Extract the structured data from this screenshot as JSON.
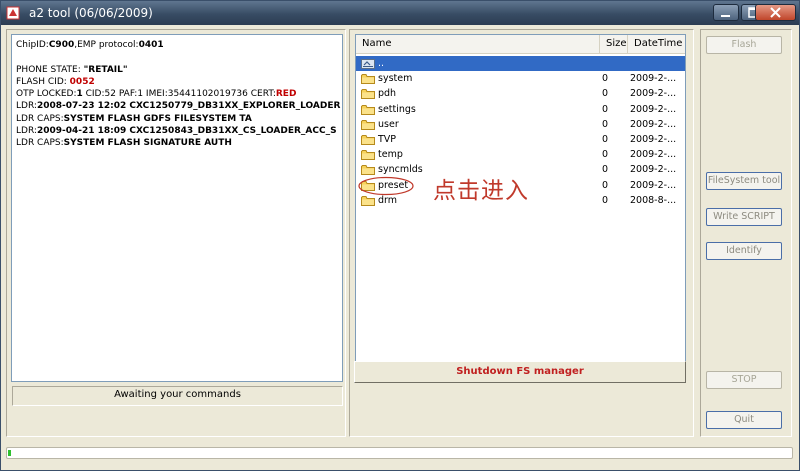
{
  "window": {
    "title": "a2 tool (06/06/2009)",
    "title_icon": "app-icon"
  },
  "info": {
    "lines": [
      {
        "prefix": "ChipID:",
        "value": "C900",
        "value_style": "bold",
        "suffix": ",EMP protocol:",
        "suffix_value": "0401"
      },
      {
        "prefix": "",
        "value": "",
        "value_style": "",
        "suffix": "",
        "suffix_value": ""
      },
      {
        "prefix": "PHONE STATE: ",
        "value": "\"RETAIL\"",
        "value_style": "bold",
        "suffix": "",
        "suffix_value": ""
      },
      {
        "prefix": "FLASH CID: ",
        "value": "0052",
        "value_style": "red",
        "suffix": "",
        "suffix_value": ""
      },
      {
        "prefix": "OTP LOCKED:",
        "value": "1",
        "value_style": "bold",
        "suffix": " CID:52 PAF:1 IMEI:35441102019736 CERT:",
        "suffix_value": "RED"
      },
      {
        "prefix": "LDR:",
        "value": "2008-07-23 12:02 CXC1250779_DB31XX_EXPLORER_LOADER",
        "value_style": "bold",
        "suffix": "",
        "suffix_value": ""
      },
      {
        "prefix": "LDR CAPS:",
        "value": "SYSTEM FLASH GDFS FILESYSTEM TA",
        "value_style": "bold",
        "suffix": "",
        "suffix_value": ""
      },
      {
        "prefix": "LDR:",
        "value": "2009-04-21 18:09 CXC1250843_DB31XX_CS_LOADER_ACC_S",
        "value_style": "bold",
        "suffix": "",
        "suffix_value": ""
      },
      {
        "prefix": "LDR CAPS:",
        "value": "SYSTEM FLASH SIGNATURE AUTH",
        "value_style": "bold",
        "suffix": "",
        "suffix_value": ""
      }
    ]
  },
  "status": {
    "text": "Awaiting your commands"
  },
  "filesystem": {
    "columns": [
      "Name",
      "Size",
      "DateTime"
    ],
    "rows": [
      {
        "name": "..",
        "size": "",
        "date": "",
        "icon": "parent-folder-icon",
        "selected": true
      },
      {
        "name": "system",
        "size": "0",
        "date": "2009-2-...",
        "icon": "folder-icon",
        "selected": false
      },
      {
        "name": "pdh",
        "size": "0",
        "date": "2009-2-...",
        "icon": "folder-icon",
        "selected": false
      },
      {
        "name": "settings",
        "size": "0",
        "date": "2009-2-...",
        "icon": "folder-icon",
        "selected": false
      },
      {
        "name": "user",
        "size": "0",
        "date": "2009-2-...",
        "icon": "folder-icon",
        "selected": false
      },
      {
        "name": "TVP",
        "size": "0",
        "date": "2009-2-...",
        "icon": "folder-icon",
        "selected": false
      },
      {
        "name": "temp",
        "size": "0",
        "date": "2009-2-...",
        "icon": "folder-icon",
        "selected": false
      },
      {
        "name": "syncmlds",
        "size": "0",
        "date": "2009-2-...",
        "icon": "folder-icon",
        "selected": false
      },
      {
        "name": "preset",
        "size": "0",
        "date": "2009-2-...",
        "icon": "folder-icon",
        "selected": false
      },
      {
        "name": "drm",
        "size": "0",
        "date": "2008-8-...",
        "icon": "folder-icon",
        "selected": false
      }
    ],
    "shutdown_label": "Shutdown FS manager"
  },
  "annotation": {
    "text": "点击进入",
    "color": "#c0392b"
  },
  "side_buttons": {
    "flash": "Flash",
    "filesystem_tool": "FileSystem tool",
    "write_script": "Write SCRIPT",
    "identify": "Identify",
    "stop": "STOP",
    "quit": "Quit"
  },
  "progress": {
    "fraction": 0.004
  },
  "colors": {
    "accent_red": "#c00000",
    "selection": "#316ac5",
    "progress": "#2fc02f"
  }
}
